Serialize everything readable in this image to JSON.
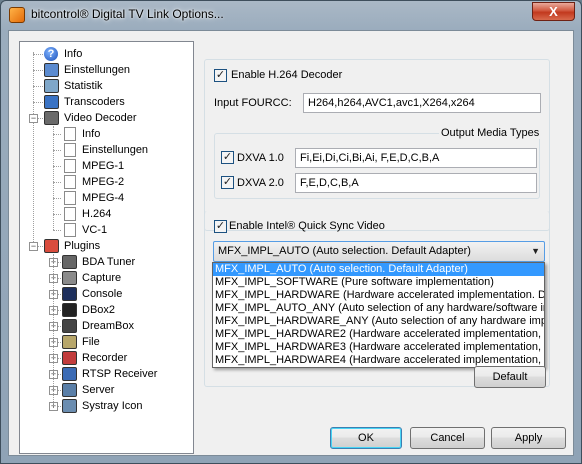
{
  "window": {
    "title": "bitcontrol® Digital TV Link Options...",
    "close_label": "X"
  },
  "tree": {
    "items": [
      {
        "label": "Info",
        "icon": "info-icon",
        "level": 0
      },
      {
        "label": "Einstellungen",
        "icon": "settings-icon",
        "level": 0
      },
      {
        "label": "Statistik",
        "icon": "statistics-icon",
        "level": 0
      },
      {
        "label": "Transcoders",
        "icon": "transcoder-icon",
        "level": 0
      },
      {
        "label": "Video Decoder",
        "icon": "video-decoder-icon",
        "level": 0,
        "expanded": true
      },
      {
        "label": "Info",
        "icon": "document-icon",
        "level": 1
      },
      {
        "label": "Einstellungen",
        "icon": "document-icon",
        "level": 1
      },
      {
        "label": "MPEG-1",
        "icon": "document-icon",
        "level": 1
      },
      {
        "label": "MPEG-2",
        "icon": "document-icon",
        "level": 1
      },
      {
        "label": "MPEG-4",
        "icon": "document-icon",
        "level": 1
      },
      {
        "label": "H.264",
        "icon": "document-icon",
        "level": 1
      },
      {
        "label": "VC-1",
        "icon": "document-icon",
        "level": 1
      },
      {
        "label": "Plugins",
        "icon": "plugins-icon",
        "level": 0,
        "expanded": true
      },
      {
        "label": "BDA Tuner",
        "icon": "tuner-icon",
        "level": 1
      },
      {
        "label": "Capture",
        "icon": "capture-icon",
        "level": 1
      },
      {
        "label": "Console",
        "icon": "console-icon",
        "level": 1
      },
      {
        "label": "DBox2",
        "icon": "dbox-icon",
        "level": 1
      },
      {
        "label": "DreamBox",
        "icon": "dreambox-icon",
        "level": 1
      },
      {
        "label": "File",
        "icon": "file-icon",
        "level": 1
      },
      {
        "label": "Recorder",
        "icon": "recorder-icon",
        "level": 1
      },
      {
        "label": "RTSP Receiver",
        "icon": "rtsp-icon",
        "level": 1
      },
      {
        "label": "Server",
        "icon": "server-icon",
        "level": 1
      },
      {
        "label": "Systray Icon",
        "icon": "systray-icon",
        "level": 1
      }
    ]
  },
  "h264": {
    "enable_label": "Enable H.264 Decoder",
    "enable_checked": true,
    "fourcc_label": "Input FOURCC:",
    "fourcc_value": "H264,h264,AVC1,avc1,X264,x264",
    "output_types_label": "Output Media Types",
    "dxva1_label": "DXVA 1.0",
    "dxva1_checked": true,
    "dxva1_value": "Fi,Ei,Di,Ci,Bi,Ai, F,E,D,C,B,A",
    "dxva2_label": "DXVA 2.0",
    "dxva2_checked": true,
    "dxva2_value": "F,E,D,C,B,A",
    "quicksync_label": "Enable Intel® Quick Sync Video",
    "quicksync_checked": true,
    "impl_selected": "MFX_IMPL_AUTO (Auto selection. Default Adapter)",
    "impl_options": [
      "MFX_IMPL_AUTO (Auto selection. Default Adapter)",
      "MFX_IMPL_SOFTWARE (Pure software implementation)",
      "MFX_IMPL_HARDWARE (Hardware accelerated implementation. Defa",
      "MFX_IMPL_AUTO_ANY (Auto selection of any hardware/software impl",
      "MFX_IMPL_HARDWARE_ANY (Auto selection of any hardware implen",
      "MFX_IMPL_HARDWARE2 (Hardware accelerated implementation, 2nd",
      "MFX_IMPL_HARDWARE3 (Hardware accelerated implementation, 3rd",
      "MFX_IMPL_HARDWARE4 (Hardware accelerated implementation, 4th"
    ],
    "default_label": "Default"
  },
  "footer": {
    "ok_label": "OK",
    "cancel_label": "Cancel",
    "apply_label": "Apply"
  }
}
